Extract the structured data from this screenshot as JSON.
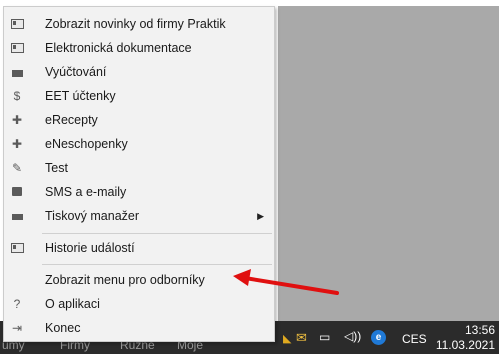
{
  "menu": {
    "items": [
      {
        "label": "Zobrazit novinky od firmy Praktik",
        "icon": "card-icon"
      },
      {
        "label": "Elektronická dokumentace",
        "icon": "card-icon"
      },
      {
        "label": "Vyúčtování",
        "icon": "envelope-icon"
      },
      {
        "label": "EET účtenky",
        "icon": "dollar-icon",
        "glyph": "$"
      },
      {
        "label": "eRecepty",
        "icon": "cross-icon",
        "glyph": "✚"
      },
      {
        "label": "eNeschopenky",
        "icon": "cross-icon",
        "glyph": "✚"
      },
      {
        "label": "Test",
        "icon": "pen-icon",
        "glyph": "✎"
      },
      {
        "label": "SMS a e-maily",
        "icon": "camera-icon"
      },
      {
        "label": "Tiskový manažer",
        "icon": "printer-icon",
        "submenu": "▶"
      },
      {
        "label": "Historie událostí",
        "icon": "card-icon"
      },
      {
        "label": "Zobrazit menu pro odborníky",
        "icon": "none"
      },
      {
        "label": "O aplikaci",
        "icon": "question-icon",
        "glyph": "?"
      },
      {
        "label": "Konec",
        "icon": "exit-icon",
        "glyph": "⇥"
      }
    ]
  },
  "taskbar": {
    "labels": [
      "ůmy",
      "Firmy",
      "Různé",
      "Moje"
    ],
    "language": "CES",
    "time": "13:56",
    "date": "11.03.2021",
    "badge_letter": "e"
  },
  "colors": {
    "menu_bg": "#f2f2f2",
    "arrow": "#e01010",
    "taskbar": "#2b2b2b"
  }
}
